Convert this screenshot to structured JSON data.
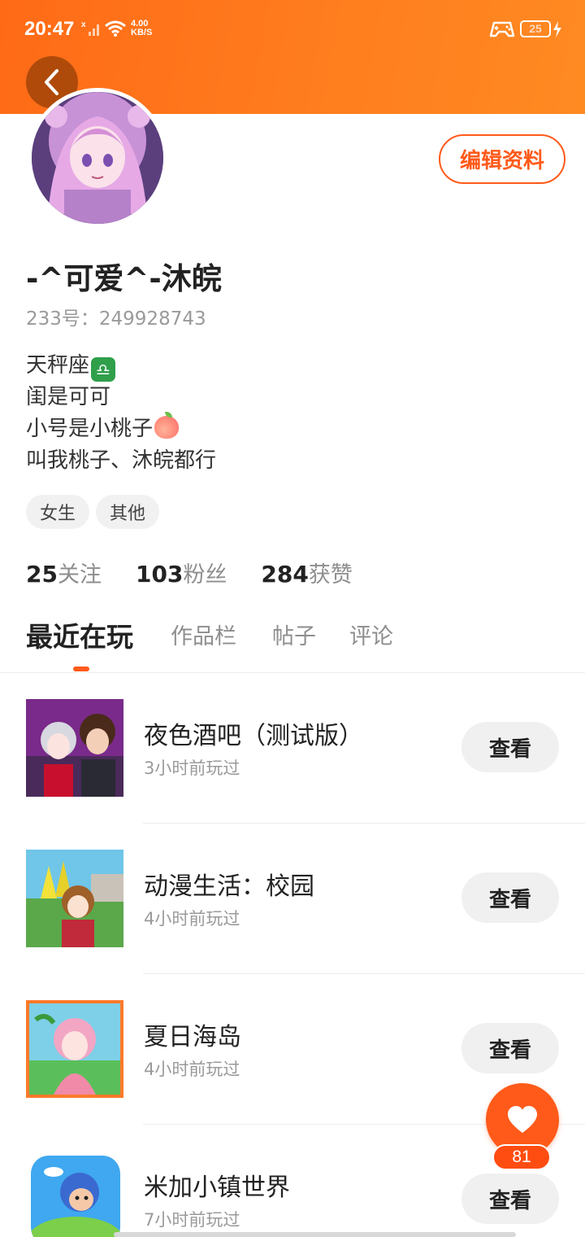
{
  "status_bar": {
    "time": "20:47",
    "net_speed_value": "4.00",
    "net_speed_unit": "KB/S",
    "battery": "25"
  },
  "colors": {
    "accent": "#ff5a1a",
    "header_start": "#ff6a16",
    "header_end": "#ff8a22"
  },
  "profile": {
    "nickname": "-^可爱^-沐皖",
    "user_id": "233号：249928743",
    "edit_label": "编辑资料",
    "bio": [
      "天秤座",
      "闺是可可",
      "小号是小桃子",
      "叫我桃子、沐皖都行"
    ],
    "tags": [
      "女生",
      "其他"
    ]
  },
  "stats": [
    {
      "value": "25",
      "label": "关注"
    },
    {
      "value": "103",
      "label": "粉丝"
    },
    {
      "value": "284",
      "label": "获赞"
    }
  ],
  "tabs": [
    "最近在玩",
    "作品栏",
    "帖子",
    "评论"
  ],
  "games": [
    {
      "title": "夜色酒吧（测试版）",
      "time": "3小时前玩过",
      "button": "查看"
    },
    {
      "title": "动漫生活：校园",
      "time": "4小时前玩过",
      "button": "查看"
    },
    {
      "title": "夏日海岛",
      "time": "4小时前玩过",
      "button": "查看"
    },
    {
      "title": "米加小镇世界",
      "time": "7小时前玩过",
      "button": "查看"
    }
  ],
  "like": {
    "count": "81"
  }
}
